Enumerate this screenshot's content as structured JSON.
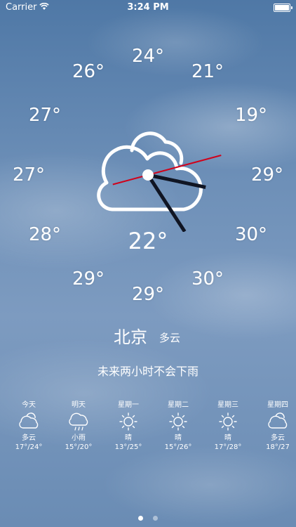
{
  "status_bar": {
    "carrier": "Carrier",
    "time": "3:24 PM"
  },
  "clock": {
    "hour_temps": [
      "22°",
      "24°",
      "21°",
      "19°",
      "29°",
      "30°",
      "30°",
      "29°",
      "29°",
      "28°",
      "27°",
      "27°",
      "26°"
    ],
    "center_temp": "22°",
    "hour_hand_pointing_hour": 3.4,
    "minute_hand_pointing_minute": 24.5,
    "second_hand_pointing_second": 12.5,
    "colors": {
      "second_hand": "#d0021b",
      "hands": "#101523",
      "cloud_stroke": "#ffffff"
    }
  },
  "location": {
    "city": "北京",
    "condition": "多云"
  },
  "rain_message": "未来两小时不会下雨",
  "forecast": [
    {
      "day": "今天",
      "icon": "cloud-icon",
      "desc": "多云",
      "temp": "17°/24°"
    },
    {
      "day": "明天",
      "icon": "rain-cloud-icon",
      "desc": "小雨",
      "temp": "15°/20°"
    },
    {
      "day": "星期一",
      "icon": "sun-icon",
      "desc": "晴",
      "temp": "13°/25°"
    },
    {
      "day": "星期二",
      "icon": "sun-icon",
      "desc": "晴",
      "temp": "15°/26°"
    },
    {
      "day": "星期三",
      "icon": "sun-icon",
      "desc": "晴",
      "temp": "17°/28°"
    },
    {
      "day": "星期四",
      "icon": "cloud-icon",
      "desc": "多云",
      "temp": "18°/27"
    }
  ],
  "pager": {
    "pages": 2,
    "current": 1
  }
}
